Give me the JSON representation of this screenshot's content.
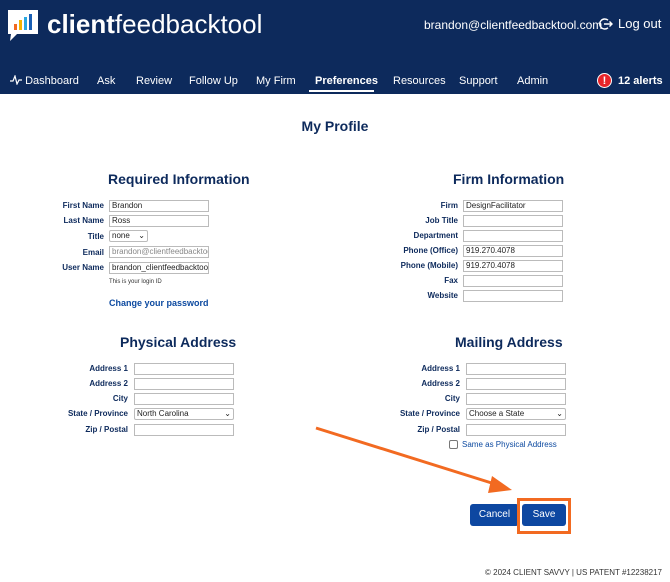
{
  "header": {
    "brand_bold": "client",
    "brand_light": "feedbacktool",
    "user_email": "brandon@clientfeedbacktool.com",
    "logout_label": "Log out",
    "alerts_label": "12 alerts"
  },
  "nav": {
    "items": [
      "Dashboard",
      "Ask",
      "Review",
      "Follow Up",
      "My Firm",
      "Preferences",
      "Resources",
      "Support",
      "Admin"
    ],
    "active": "Preferences"
  },
  "page": {
    "title": "My Profile"
  },
  "required": {
    "title": "Required Information",
    "first_name_label": "First Name",
    "first_name": "Brandon",
    "last_name_label": "Last Name",
    "last_name": "Ross",
    "title_label": "Title",
    "title_value": "none",
    "email_label": "Email",
    "email": "brandon@clientfeedbacktool.com",
    "username_label": "User Name",
    "username": "brandon_clientfeedbacktool",
    "hint": "This is your login ID",
    "change_password": "Change your password"
  },
  "firm": {
    "title": "Firm Information",
    "firm_label": "Firm",
    "firm": "DesignFacilitator",
    "job_title_label": "Job Title",
    "job_title": "",
    "department_label": "Department",
    "department": "",
    "phone_office_label": "Phone (Office)",
    "phone_office": "919.270.4078",
    "phone_mobile_label": "Phone (Mobile)",
    "phone_mobile": "919.270.4078",
    "fax_label": "Fax",
    "fax": "",
    "website_label": "Website",
    "website": ""
  },
  "physical": {
    "title": "Physical Address",
    "address1_label": "Address 1",
    "address2_label": "Address 2",
    "city_label": "City",
    "state_label": "State / Province",
    "state": "North Carolina",
    "zip_label": "Zip / Postal"
  },
  "mailing": {
    "title": "Mailing Address",
    "address1_label": "Address 1",
    "address2_label": "Address 2",
    "city_label": "City",
    "state_label": "State / Province",
    "state": "Choose a State",
    "zip_label": "Zip / Postal",
    "same_as_label": "Same as Physical Address"
  },
  "actions": {
    "cancel": "Cancel",
    "save": "Save"
  },
  "footer": {
    "text": "© 2024 CLIENT SAVVY | US PATENT #12238217"
  },
  "colors": {
    "navy": "#0d2a5c",
    "button": "#0d47a1",
    "highlight": "#f26a21",
    "alert": "#e8252a"
  }
}
